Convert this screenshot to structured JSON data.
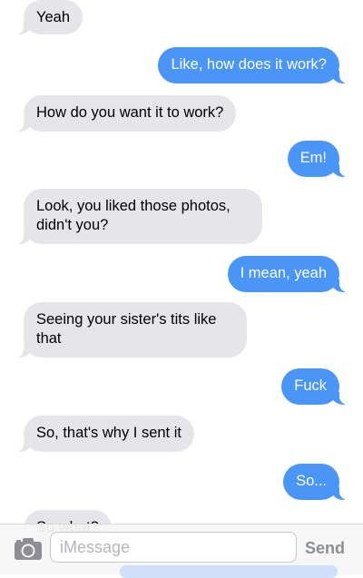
{
  "messages": [
    {
      "from": "them",
      "text": "Yeah"
    },
    {
      "from": "me",
      "text": "Like, how does it work?"
    },
    {
      "from": "them",
      "text": "How do you want it to work?"
    },
    {
      "from": "me",
      "text": "Em!"
    },
    {
      "from": "them",
      "text": "Look, you liked those photos, didn't you?"
    },
    {
      "from": "me",
      "text": "I mean, yeah"
    },
    {
      "from": "them",
      "text": "Seeing your sister's tits like that"
    },
    {
      "from": "me",
      "text": "Fuck"
    },
    {
      "from": "them",
      "text": "So, that's why I sent it"
    },
    {
      "from": "me",
      "text": "So..."
    },
    {
      "from": "them",
      "text": "So what?"
    }
  ],
  "composer": {
    "placeholder": "iMessage",
    "send_label": "Send",
    "camera_icon": "camera-icon"
  },
  "colors": {
    "incoming_bubble": "#e5e5ea",
    "outgoing_bubble": "#4a95f8",
    "send_disabled": "#8e8e93"
  }
}
